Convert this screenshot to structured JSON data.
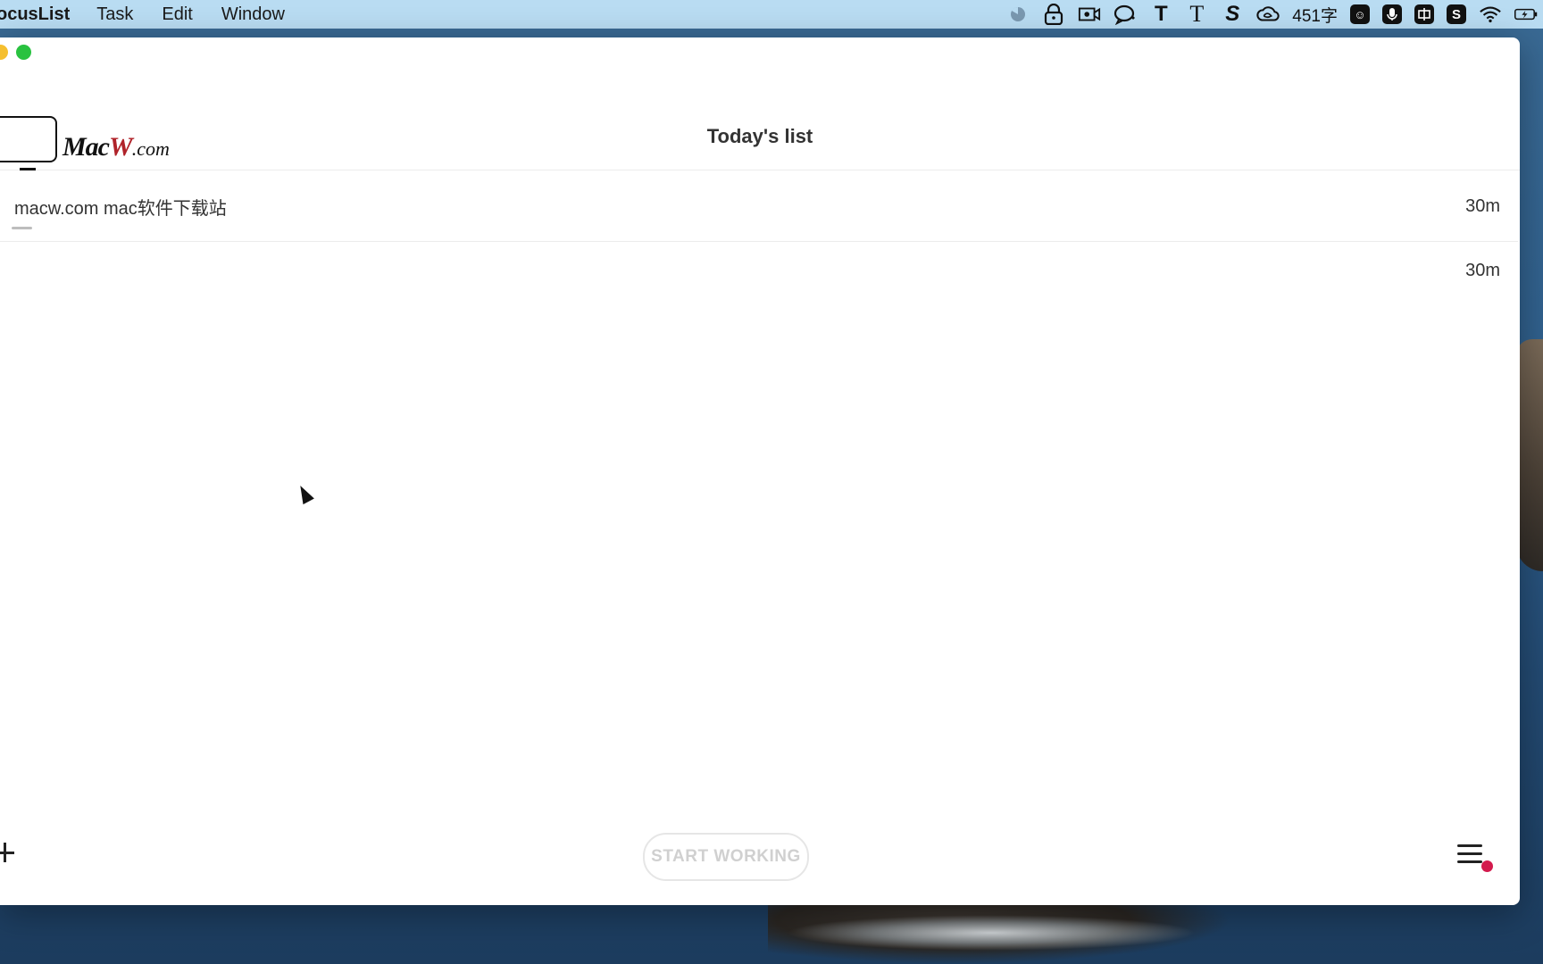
{
  "menubar": {
    "app_name": "ocusList",
    "items": [
      "Task",
      "Edit",
      "Window"
    ],
    "status_word_count": "451字"
  },
  "window": {
    "title": "Today's list",
    "logo": {
      "brand": "MacW",
      "suffix": ".com"
    },
    "tasks": [
      {
        "text": "macw.com  mac软件下载站",
        "duration": "30m"
      },
      {
        "text": "",
        "duration": "30m"
      }
    ],
    "start_button": "START WORKING"
  },
  "colors": {
    "menubar_bg": "#b9dcf2",
    "traffic_yellow": "#f5bf2f",
    "traffic_green": "#29c240",
    "notification_dot": "#d31a4d",
    "logo_accent": "#b0232a"
  },
  "icons": [
    "timer-icon",
    "lock-icon",
    "screen-record-icon",
    "chat-icon",
    "text-t-icon",
    "text-serif-t-icon",
    "s-icon",
    "creative-cloud-icon",
    "emoji-icon",
    "microphone-icon",
    "input-method-icon",
    "sogou-icon",
    "wifi-icon",
    "battery-charging-icon"
  ]
}
